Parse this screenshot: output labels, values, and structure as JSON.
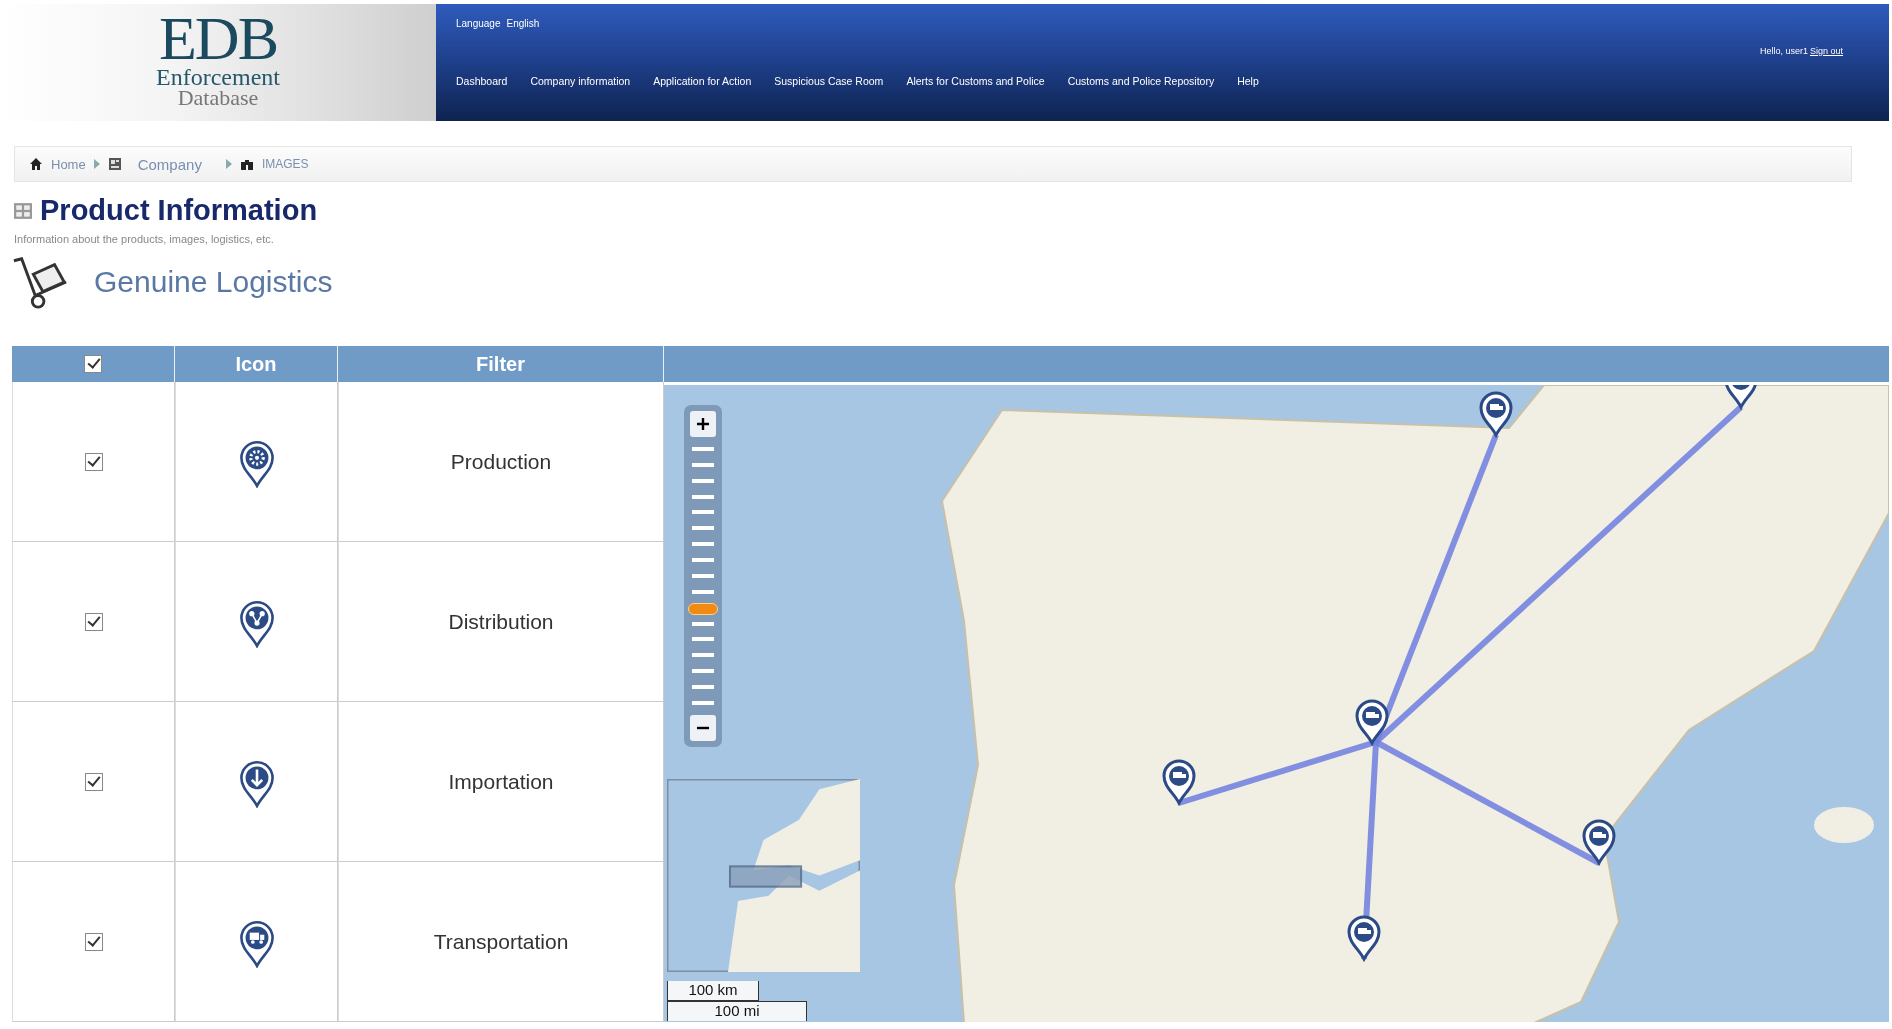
{
  "logo": {
    "mark": "EDB",
    "line1": "Enforcement",
    "line2": "Database"
  },
  "header": {
    "language_label": "Language",
    "language": "English",
    "greeting": "Hello, user1",
    "sign_out": "Sign out"
  },
  "nav": [
    {
      "label": "Dashboard"
    },
    {
      "label": "Company information"
    },
    {
      "label": "Application for Action"
    },
    {
      "label": "Suspicious Case Room"
    },
    {
      "label": "Alerts for Customs and Police"
    },
    {
      "label": "Customs and Police Repository"
    },
    {
      "label": "Help"
    }
  ],
  "breadcrumb": [
    {
      "label": "Home",
      "kind": "home"
    },
    {
      "label": "Company",
      "kind": "company"
    },
    {
      "label": "IMAGES",
      "kind": "images"
    }
  ],
  "page": {
    "title": "Product Information",
    "subtitle": "Information about the products, images, logistics, etc.",
    "section": "Genuine Logistics"
  },
  "table": {
    "header_checked": true,
    "columns": [
      "Icon",
      "Filter"
    ],
    "rows": [
      {
        "checked": true,
        "kind": "production",
        "filter": "Production"
      },
      {
        "checked": true,
        "kind": "distribution",
        "filter": "Distribution"
      },
      {
        "checked": true,
        "kind": "importation",
        "filter": "Importation"
      },
      {
        "checked": true,
        "kind": "transportation",
        "filter": "Transportation"
      }
    ]
  },
  "map": {
    "zoom": {
      "level": 0.38
    },
    "scale": [
      "100 km",
      "100 mi"
    ]
  }
}
